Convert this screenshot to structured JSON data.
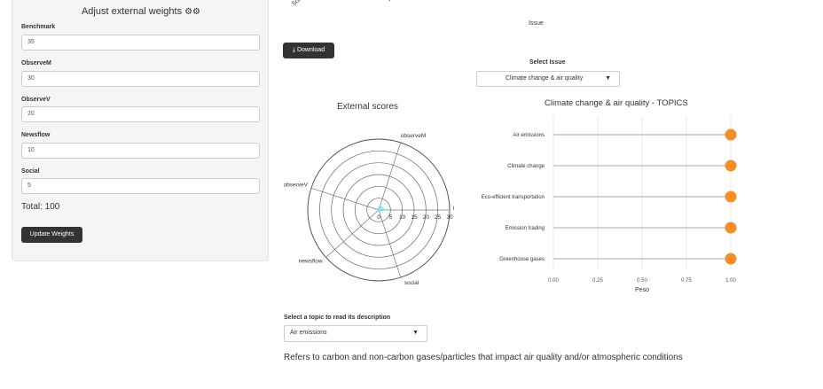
{
  "weights_panel": {
    "title": "Adjust external weights",
    "fields": [
      {
        "label": "Benchmark",
        "value": "35"
      },
      {
        "label": "ObserveM",
        "value": "30"
      },
      {
        "label": "ObserveV",
        "value": "20"
      },
      {
        "label": "Newsflow",
        "value": "10"
      },
      {
        "label": "Social",
        "value": "5"
      }
    ],
    "total": "Total: 100",
    "update_button": "Update Weights"
  },
  "top_chart": {
    "axis_title": "Issue",
    "tick_fragments": [
      "Solvency",
      "Re"
    ]
  },
  "download_button": "Download",
  "issue_select": {
    "label": "Select Issue",
    "value": "Climate change & air quality"
  },
  "chart_data": [
    {
      "type": "radar",
      "title": "External scores",
      "axes": [
        "observeM",
        "observeV",
        "newsflow",
        "social",
        "l"
      ],
      "radial_ticks": [
        "0",
        "5",
        "10",
        "15",
        "20",
        "25",
        "30"
      ],
      "rlim": [
        0,
        30
      ],
      "values": [
        2,
        1,
        0.5,
        0.5,
        3
      ]
    },
    {
      "type": "scatter",
      "title": "Climate change & air quality - TOPICS",
      "categories": [
        "Air emissions",
        "Climate change",
        "Eco-efficient transportation",
        "Emission trading",
        "Greenhouse gases"
      ],
      "values": [
        1.0,
        1.0,
        1.0,
        1.0,
        1.0
      ],
      "xlabel": "Peso",
      "xticks": [
        "0.00",
        "0.25",
        "0.50",
        "0.75",
        "1.00"
      ],
      "xlim": [
        0,
        1
      ],
      "color": "#f28e2b"
    }
  ],
  "topic_select": {
    "label": "Select a topic to read its description",
    "value": "Air emissions"
  },
  "description": "Refers to carbon and non-carbon gases/particles that impact air quality and/or atmospheric conditions"
}
